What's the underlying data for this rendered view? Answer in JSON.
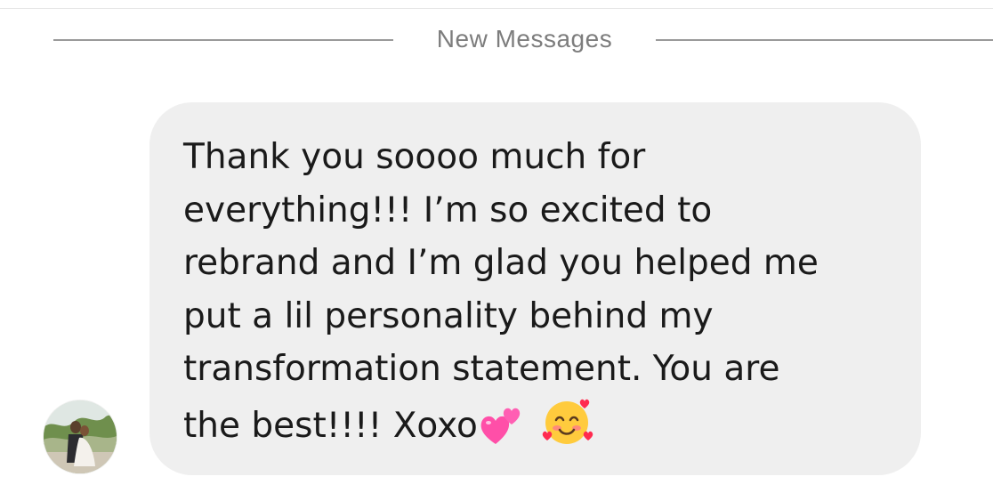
{
  "divider": {
    "label": "New Messages"
  },
  "message": {
    "lines": [
      "Thank you soooo much for",
      "everything!!! I’m so excited to",
      "rebrand and I’m glad you helped me",
      "put a lil personality behind my",
      "transformation statement. You are",
      "the best!!!! Xoxo"
    ],
    "emojis": [
      "two-hearts-icon",
      "smiling-face-with-hearts-icon"
    ]
  },
  "colors": {
    "bubble_background": "#efefef",
    "divider": "#9a9a9a",
    "divider_label": "#7d7d7d",
    "text": "#1a1a1a"
  }
}
